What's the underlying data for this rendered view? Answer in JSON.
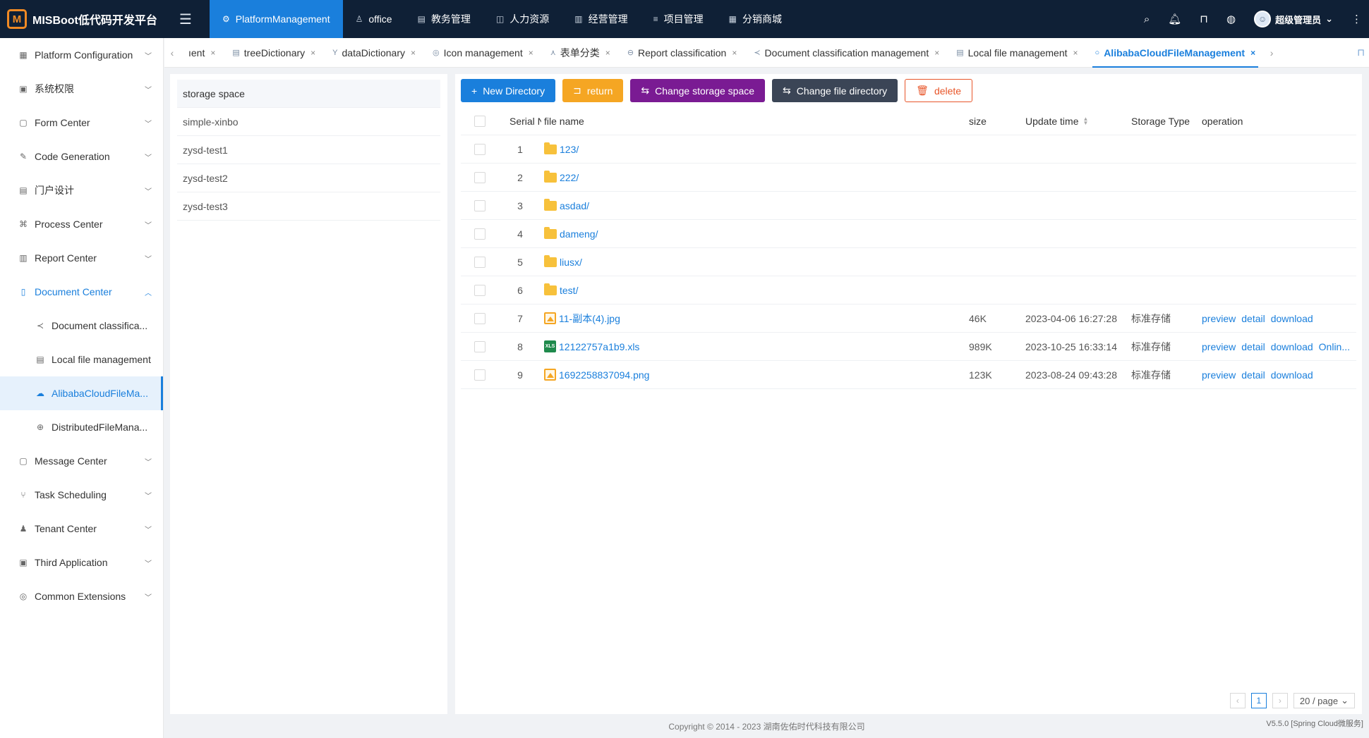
{
  "app": {
    "logo_text": "MISBoot低代码开发平台"
  },
  "topnav": [
    {
      "label": "PlatformManagement",
      "icon": "gear-icon",
      "glyph": "⚙"
    },
    {
      "label": "office",
      "icon": "user-icon",
      "glyph": "♙"
    },
    {
      "label": "教务管理",
      "icon": "book-icon",
      "glyph": "▤"
    },
    {
      "label": "人力资源",
      "icon": "people-icon",
      "glyph": "◫"
    },
    {
      "label": "经营管理",
      "icon": "chart-icon",
      "glyph": "▥"
    },
    {
      "label": "项目管理",
      "icon": "list-icon",
      "glyph": "≡"
    },
    {
      "label": "分销商城",
      "icon": "store-icon",
      "glyph": "▦"
    }
  ],
  "user": {
    "name": "超级管理员"
  },
  "sidebar": [
    {
      "label": "Platform Configuration",
      "glyph": "▦"
    },
    {
      "label": "系统权限",
      "glyph": "▣"
    },
    {
      "label": "Form Center",
      "glyph": "▢"
    },
    {
      "label": "Code Generation",
      "glyph": "✎"
    },
    {
      "label": "门户设计",
      "glyph": "▤"
    },
    {
      "label": "Process Center",
      "glyph": "⌘"
    },
    {
      "label": "Report Center",
      "glyph": "▥"
    },
    {
      "label": "Document Center",
      "glyph": "▯"
    },
    {
      "label": "Document classifica...",
      "glyph": "≺"
    },
    {
      "label": "Local file management",
      "glyph": "▤"
    },
    {
      "label": "AlibabaCloudFileMa...",
      "glyph": "☁"
    },
    {
      "label": "DistributedFileMana...",
      "glyph": "⊕"
    },
    {
      "label": "Message Center",
      "glyph": "▢"
    },
    {
      "label": "Task Scheduling",
      "glyph": "⑂"
    },
    {
      "label": "Tenant Center",
      "glyph": "♟"
    },
    {
      "label": "Third Application",
      "glyph": "▣"
    },
    {
      "label": "Common Extensions",
      "glyph": "◎"
    }
  ],
  "tabs": [
    {
      "label": "ıent",
      "glyph": ""
    },
    {
      "label": "treeDictionary",
      "glyph": "▤"
    },
    {
      "label": "dataDictionary",
      "glyph": "Y"
    },
    {
      "label": "Icon management",
      "glyph": "◎"
    },
    {
      "label": "表单分类",
      "glyph": "⋏"
    },
    {
      "label": "Report classification",
      "glyph": "⊖"
    },
    {
      "label": "Document classification management",
      "glyph": "≺"
    },
    {
      "label": "Local file management",
      "glyph": "▤"
    },
    {
      "label": "AlibabaCloudFileManagement",
      "glyph": "○"
    }
  ],
  "storage": {
    "header": "storage space",
    "items": [
      "simple-xinbo",
      "zysd-test1",
      "zysd-test2",
      "zysd-test3"
    ]
  },
  "toolbar": {
    "new_dir": "New Directory",
    "return": "return",
    "change_storage": "Change storage space",
    "change_dir": "Change file directory",
    "delete": "delete"
  },
  "table": {
    "headers": {
      "serial": "Serial N",
      "name": "file name",
      "size": "size",
      "time": "Update time",
      "type": "Storage Type",
      "operation": "operation"
    },
    "rows": [
      {
        "serial": "1",
        "name": "123/",
        "kind": "folder",
        "size": "",
        "time": "",
        "type": "",
        "ops": []
      },
      {
        "serial": "2",
        "name": "222/",
        "kind": "folder",
        "size": "",
        "time": "",
        "type": "",
        "ops": []
      },
      {
        "serial": "3",
        "name": "asdad/",
        "kind": "folder",
        "size": "",
        "time": "",
        "type": "",
        "ops": []
      },
      {
        "serial": "4",
        "name": "dameng/",
        "kind": "folder",
        "size": "",
        "time": "",
        "type": "",
        "ops": []
      },
      {
        "serial": "5",
        "name": "liusx/",
        "kind": "folder",
        "size": "",
        "time": "",
        "type": "",
        "ops": []
      },
      {
        "serial": "6",
        "name": "test/",
        "kind": "folder",
        "size": "",
        "time": "",
        "type": "",
        "ops": []
      },
      {
        "serial": "7",
        "name": "11-副本(4).jpg",
        "kind": "image",
        "size": "46K",
        "time": "2023-04-06 16:27:28",
        "type": "标准存储",
        "ops": [
          "preview",
          "detail",
          "download"
        ]
      },
      {
        "serial": "8",
        "name": "12122757a1b9.xls",
        "kind": "excel",
        "size": "989K",
        "time": "2023-10-25 16:33:14",
        "type": "标准存储",
        "ops": [
          "preview",
          "detail",
          "download",
          "Onlin..."
        ]
      },
      {
        "serial": "9",
        "name": "1692258837094.png",
        "kind": "image",
        "size": "123K",
        "time": "2023-08-24 09:43:28",
        "type": "标准存储",
        "ops": [
          "preview",
          "detail",
          "download"
        ]
      }
    ]
  },
  "pagination": {
    "current": "1",
    "page_size": "20 / page"
  },
  "footer": {
    "copyright": "Copyright © 2014 - 2023 湖南佐佑时代科技有限公司",
    "version": "V5.5.0 [Spring Cloud微服务]"
  }
}
